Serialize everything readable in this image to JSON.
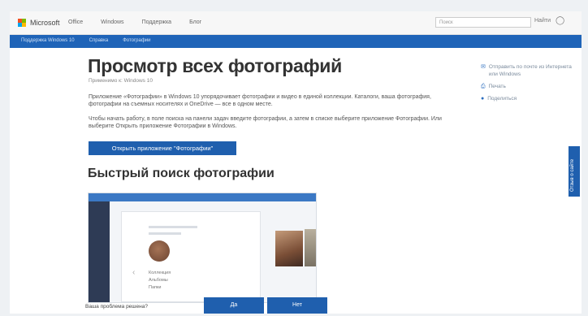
{
  "header": {
    "logo_text": "Microsoft",
    "nav": [
      "Office",
      "Windows",
      "Поддержка",
      "Блог"
    ],
    "search_placeholder": "Поиск",
    "search_button": "Найти"
  },
  "breadcrumbs": [
    "Поддержка Windows 10",
    "Справка",
    "Фотографии"
  ],
  "main": {
    "title": "Просмотр всех фотографий",
    "subtitle": "Применимо к: Windows 10",
    "paragraph1": "Приложение «Фотографии» в Windows 10 упорядочивает фотографии и видео в единой коллекции. Каталоги, ваша фотография, фотографии на съемных носителях и OneDrive — все в одном месте.",
    "paragraph2": "Чтобы начать работу, в поле поиска на панели задач введите фотографии, а затем в списке выберите приложение Фотографии. Или выберите Открыть приложение Фотографии в Windows.",
    "cta_button": "Открыть приложение \"Фотографии\"",
    "section_heading": "Быстрый поиск фотографии"
  },
  "embedded_screenshot": {
    "list_items": [
      "Коллекция",
      "Альбомы",
      "Папки"
    ]
  },
  "sidebar": {
    "items": [
      {
        "icon": "envelope-icon",
        "label": "Отправить по почте из Интернета или Windows"
      },
      {
        "icon": "print-icon",
        "label": "Печать"
      },
      {
        "icon": "people-icon",
        "label": "Поделиться"
      }
    ]
  },
  "feedback": {
    "side_tab": "Отзыв о сайте",
    "question": "Ваша проблема решена?",
    "yes": "Да",
    "no": "Нет"
  },
  "colors": {
    "accent": "#1f5fae",
    "bar": "#1f64b8"
  }
}
